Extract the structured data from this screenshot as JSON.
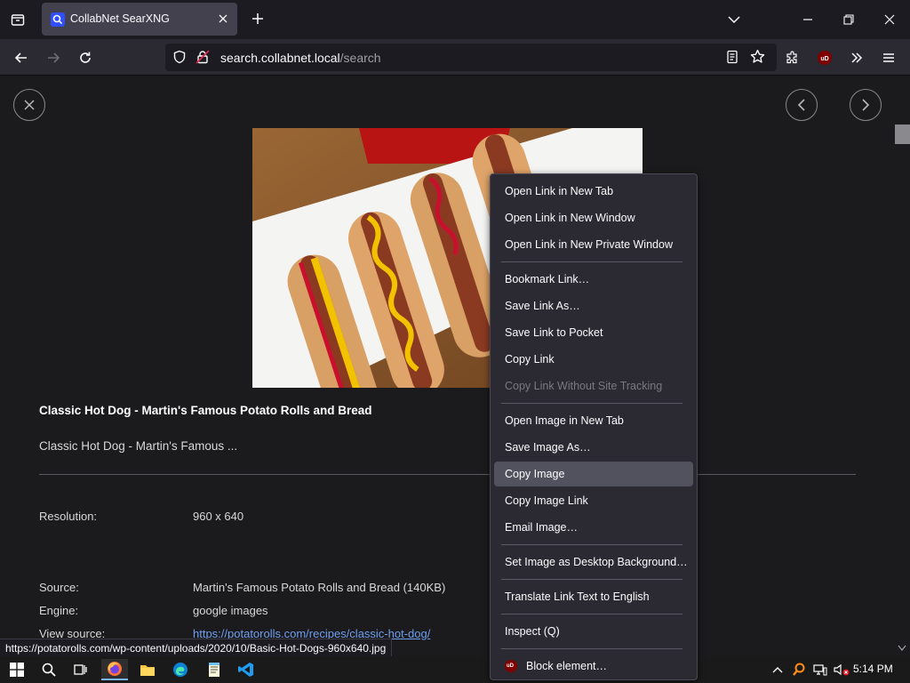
{
  "tab": {
    "title": "CollabNet SearXNG"
  },
  "urlbar": {
    "host": "search.collabnet.local",
    "path": "/search"
  },
  "detail": {
    "title": "Classic Hot Dog - Martin's Famous Potato Rolls and Bread",
    "description": "Classic Hot Dog - Martin's Famous ...",
    "fields": [
      {
        "label": "Resolution:",
        "value": "960 x 640"
      },
      {
        "label": "Source:",
        "value": "Martin's Famous Potato Rolls and Bread (140KB)"
      },
      {
        "label": "Engine:",
        "value": "google images"
      },
      {
        "label": "View source:",
        "value": "https://potatorolls.com/recipes/classic-hot-dog/"
      }
    ]
  },
  "status_link": "https://potatorolls.com/wp-content/uploads/2020/10/Basic-Hot-Dogs-960x640.jpg",
  "context_menu": {
    "items": [
      "Open Link in New Tab",
      "Open Link in New Window",
      "Open Link in New Private Window",
      "Bookmark Link…",
      "Save Link As…",
      "Save Link to Pocket",
      "Copy Link",
      "Copy Link Without Site Tracking",
      "Open Image in New Tab",
      "Save Image As…",
      "Copy Image",
      "Copy Image Link",
      "Email Image…",
      "Set Image as Desktop Background…",
      "Translate Link Text to English",
      "Inspect (Q)",
      "Block element…"
    ],
    "disabled_item": "Copy Link Without Site Tracking",
    "highlighted_item": "Copy Image"
  },
  "taskbar": {
    "time": "5:14 PM"
  },
  "colors": {
    "accent": "#7ab3ff",
    "link": "#6f9ff0",
    "menu_bg": "#2b2a33"
  }
}
